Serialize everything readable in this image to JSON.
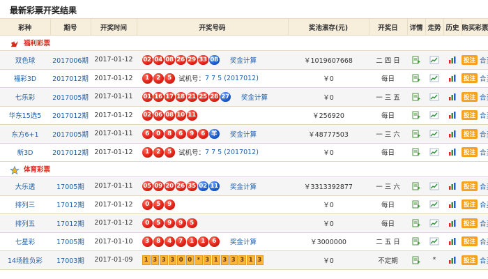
{
  "title": "最新彩票开奖结果",
  "headers": [
    "彩种",
    "期号",
    "开奖时间",
    "开奖号码",
    "奖池滚存(元)",
    "开奖日",
    "详情",
    "走势",
    "历史",
    "购买彩票"
  ],
  "labels": {
    "trial": "试机号：",
    "calc": "奖金计算",
    "bet": "投注",
    "hemai": "合买"
  },
  "groups": [
    {
      "name": "福利彩票",
      "rows": [
        {
          "name": "双色球",
          "issue": "2017006期",
          "date": "2017-01-12",
          "balls": [
            {
              "n": "02",
              "c": "red"
            },
            {
              "n": "04",
              "c": "red"
            },
            {
              "n": "08",
              "c": "red"
            },
            {
              "n": "26",
              "c": "red"
            },
            {
              "n": "29",
              "c": "red"
            },
            {
              "n": "33",
              "c": "red"
            },
            {
              "n": "08",
              "c": "blue"
            }
          ],
          "extra_type": "calc",
          "extra": "",
          "pool": "￥1019607668",
          "days": "二 四 日"
        },
        {
          "name": "福彩3D",
          "issue": "2017012期",
          "date": "2017-01-12",
          "balls": [
            {
              "n": "1",
              "c": "red"
            },
            {
              "n": "2",
              "c": "red"
            },
            {
              "n": "5",
              "c": "red"
            }
          ],
          "extra_type": "trial",
          "extra": "7 7 5 (2017012)",
          "pool": "￥0",
          "days": "每日"
        },
        {
          "name": "七乐彩",
          "issue": "2017005期",
          "date": "2017-01-11",
          "balls": [
            {
              "n": "01",
              "c": "red"
            },
            {
              "n": "16",
              "c": "red"
            },
            {
              "n": "17",
              "c": "red"
            },
            {
              "n": "18",
              "c": "red"
            },
            {
              "n": "21",
              "c": "red"
            },
            {
              "n": "25",
              "c": "red"
            },
            {
              "n": "28",
              "c": "red"
            },
            {
              "n": "27",
              "c": "blue"
            }
          ],
          "extra_type": "calc",
          "extra": "",
          "pool": "￥0",
          "days": "一 三 五"
        },
        {
          "name": "华东15选5",
          "issue": "2017012期",
          "date": "2017-01-12",
          "balls": [
            {
              "n": "02",
              "c": "red"
            },
            {
              "n": "06",
              "c": "red"
            },
            {
              "n": "08",
              "c": "red"
            },
            {
              "n": "10",
              "c": "red"
            },
            {
              "n": "11",
              "c": "red"
            }
          ],
          "extra_type": "none",
          "extra": "",
          "pool": "￥256920",
          "days": "每日"
        },
        {
          "name": "东方6+1",
          "issue": "2017005期",
          "date": "2017-01-11",
          "balls": [
            {
              "n": "6",
              "c": "red"
            },
            {
              "n": "0",
              "c": "red"
            },
            {
              "n": "8",
              "c": "red"
            },
            {
              "n": "6",
              "c": "red"
            },
            {
              "n": "9",
              "c": "red"
            },
            {
              "n": "6",
              "c": "red"
            },
            {
              "n": "羊",
              "c": "blue"
            }
          ],
          "extra_type": "calc",
          "extra": "",
          "pool": "￥48777503",
          "days": "一 三 六"
        },
        {
          "name": "新3D",
          "issue": "2017012期",
          "date": "2017-01-12",
          "balls": [
            {
              "n": "1",
              "c": "red"
            },
            {
              "n": "2",
              "c": "red"
            },
            {
              "n": "5",
              "c": "red"
            }
          ],
          "extra_type": "trial",
          "extra": "7 7 5 (2017012)",
          "pool": "￥0",
          "days": "每日"
        }
      ]
    },
    {
      "name": "体育彩票",
      "rows": [
        {
          "name": "大乐透",
          "issue": "17005期",
          "date": "2017-01-11",
          "balls": [
            {
              "n": "05",
              "c": "red"
            },
            {
              "n": "09",
              "c": "red"
            },
            {
              "n": "20",
              "c": "red"
            },
            {
              "n": "26",
              "c": "red"
            },
            {
              "n": "35",
              "c": "red"
            },
            {
              "n": "02",
              "c": "blue"
            },
            {
              "n": "11",
              "c": "blue"
            }
          ],
          "extra_type": "calc",
          "extra": "",
          "pool": "￥3313392877",
          "days": "一 三 六"
        },
        {
          "name": "排列三",
          "issue": "17012期",
          "date": "2017-01-12",
          "balls": [
            {
              "n": "0",
              "c": "red"
            },
            {
              "n": "5",
              "c": "red"
            },
            {
              "n": "9",
              "c": "red"
            }
          ],
          "extra_type": "none",
          "extra": "",
          "pool": "￥0",
          "days": "每日"
        },
        {
          "name": "排列五",
          "issue": "17012期",
          "date": "2017-01-12",
          "balls": [
            {
              "n": "0",
              "c": "red"
            },
            {
              "n": "5",
              "c": "red"
            },
            {
              "n": "9",
              "c": "red"
            },
            {
              "n": "9",
              "c": "red"
            },
            {
              "n": "5",
              "c": "red"
            }
          ],
          "extra_type": "none",
          "extra": "",
          "pool": "￥0",
          "days": "每日"
        },
        {
          "name": "七星彩",
          "issue": "17005期",
          "date": "2017-01-10",
          "balls": [
            {
              "n": "3",
              "c": "red"
            },
            {
              "n": "8",
              "c": "red"
            },
            {
              "n": "4",
              "c": "red"
            },
            {
              "n": "7",
              "c": "red"
            },
            {
              "n": "1",
              "c": "red"
            },
            {
              "n": "1",
              "c": "red"
            },
            {
              "n": "6",
              "c": "red"
            }
          ],
          "extra_type": "calc",
          "extra": "",
          "pool": "￥3000000",
          "days": "二 五 日"
        },
        {
          "name": "14场胜负彩",
          "issue": "17003期",
          "date": "2017-01-09",
          "squares": [
            "1",
            "3",
            "3",
            "3",
            "0",
            "0",
            "*",
            "3",
            "1",
            "3",
            "3",
            "3",
            "1",
            "3"
          ],
          "extra_type": "none",
          "extra": "",
          "pool": "￥0",
          "days": "不定期",
          "trend": "*"
        }
      ]
    }
  ],
  "colors": {
    "header_bg": "#f7eedc",
    "ball_red": "#e0261a",
    "ball_blue": "#1f5fd0",
    "link": "#1f5fa8",
    "bet_button": "#f4a21f",
    "group_title": "#d52b1e"
  },
  "icons": {
    "welfare_group": "welfare-lottery-logo-icon",
    "sports_group": "sports-lottery-star-icon",
    "detail": "detail-document-icon",
    "trend": "trend-line-icon",
    "history": "history-bar-chart-icon"
  }
}
